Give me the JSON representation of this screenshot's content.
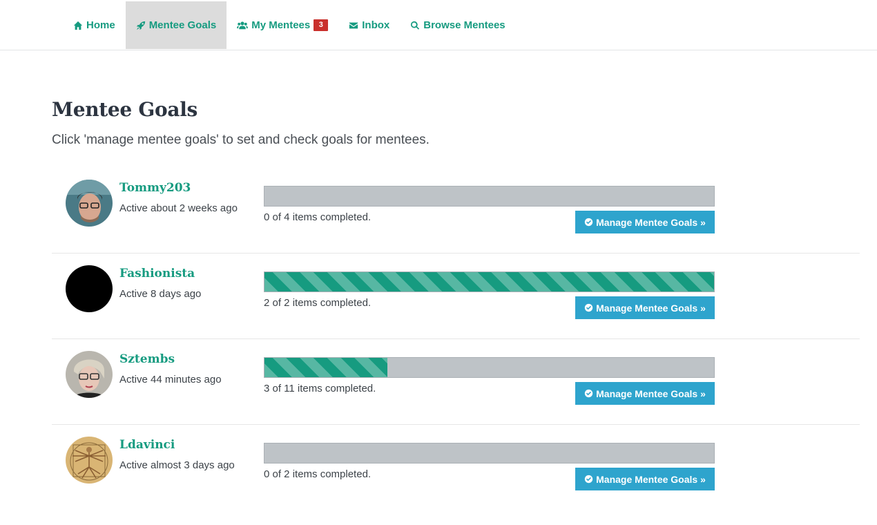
{
  "nav": {
    "items": [
      {
        "label": "Home",
        "icon": "home-icon"
      },
      {
        "label": "Mentee Goals",
        "icon": "rocket-icon",
        "active": true
      },
      {
        "label": "My Mentees",
        "icon": "users-icon",
        "badge": "3"
      },
      {
        "label": "Inbox",
        "icon": "envelope-icon"
      },
      {
        "label": "Browse Mentees",
        "icon": "search-icon"
      }
    ]
  },
  "page": {
    "title": "Mentee Goals",
    "subtitle": "Click 'manage mentee goals' to set and check goals for mentees."
  },
  "colors": {
    "accent": "#169b80",
    "button": "#2ea4cd",
    "badge": "#c9302c",
    "track": "#bec3c7"
  },
  "mentees": [
    {
      "name": "Tommy203",
      "active": "Active about 2 weeks ago",
      "progress_text": "0 of 4 items completed.",
      "completed": 0,
      "total": 4,
      "button_label": "Manage Mentee Goals »"
    },
    {
      "name": "Fashionista",
      "active": "Active 8 days ago",
      "progress_text": "2 of 2 items completed.",
      "completed": 2,
      "total": 2,
      "button_label": "Manage Mentee Goals »"
    },
    {
      "name": "Sztembs",
      "active": "Active 44 minutes ago",
      "progress_text": "3 of 11 items completed.",
      "completed": 3,
      "total": 11,
      "button_label": "Manage Mentee Goals »"
    },
    {
      "name": "Ldavinci",
      "active": "Active almost 3 days ago",
      "progress_text": "0 of 2 items completed.",
      "completed": 0,
      "total": 2,
      "button_label": "Manage Mentee Goals »"
    }
  ]
}
